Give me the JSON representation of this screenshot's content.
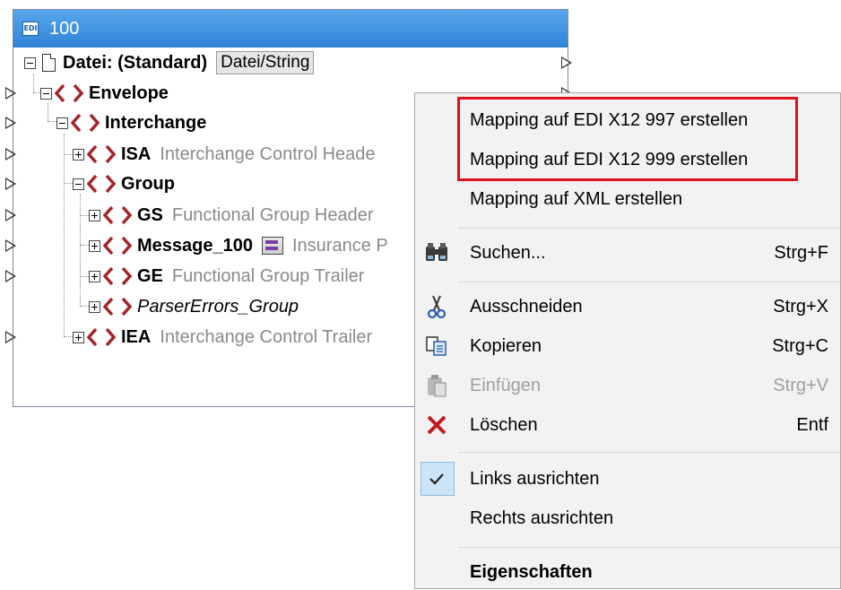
{
  "component": {
    "title": "100",
    "icon": "edi-icon",
    "root_label": "Datei: (Standard)",
    "root_button": "Datei/String",
    "tree": {
      "envelope": "Envelope",
      "interchange": "Interchange",
      "isa": {
        "name": "ISA",
        "desc": "Interchange Control Heade"
      },
      "group": "Group",
      "gs": {
        "name": "GS",
        "desc": "Functional Group Header"
      },
      "message": {
        "name": "Message_100",
        "desc": "Insurance P"
      },
      "ge": {
        "name": "GE",
        "desc": "Functional Group Trailer"
      },
      "parser_errors": "ParserErrors_Group",
      "iea": {
        "name": "IEA",
        "desc": "Interchange Control Trailer"
      }
    }
  },
  "context_menu": {
    "items": [
      {
        "label": "Mapping auf EDI X12 997 erstellen",
        "shortcut": ""
      },
      {
        "label": "Mapping auf EDI X12 999 erstellen",
        "shortcut": ""
      },
      {
        "label": "Mapping auf XML erstellen",
        "shortcut": ""
      },
      {
        "label": "Suchen...",
        "shortcut": "Strg+F",
        "icon": "binoculars-icon"
      },
      {
        "label": "Ausschneiden",
        "shortcut": "Strg+X",
        "icon": "scissors-icon"
      },
      {
        "label": "Kopieren",
        "shortcut": "Strg+C",
        "icon": "copy-icon"
      },
      {
        "label": "Einfügen",
        "shortcut": "Strg+V",
        "icon": "paste-icon",
        "disabled": true
      },
      {
        "label": "Löschen",
        "shortcut": "Entf",
        "icon": "delete-icon"
      },
      {
        "label": "Links ausrichten",
        "shortcut": "",
        "icon": "check-icon",
        "checked": true
      },
      {
        "label": "Rechts ausrichten",
        "shortcut": ""
      },
      {
        "label": "Eigenschaften",
        "shortcut": ""
      }
    ]
  },
  "colors": {
    "highlight_border": "#e0121b",
    "tag_icon": "#a3252b",
    "title_bar": "#3b8fdf"
  }
}
